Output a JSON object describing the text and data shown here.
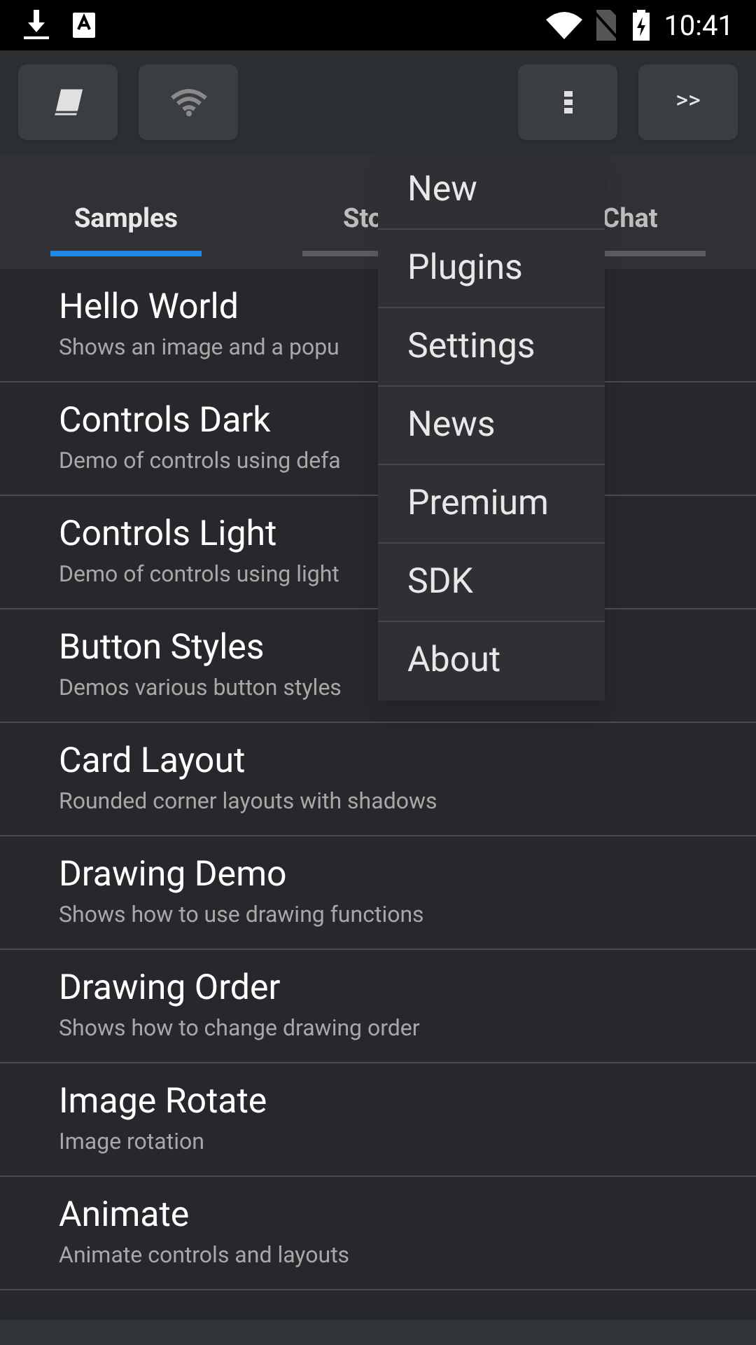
{
  "status_bar": {
    "time": "10:41"
  },
  "toolbar": {
    "forward_button": {
      "label": ">>"
    }
  },
  "tabs": [
    {
      "label": "Samples",
      "selected": true
    },
    {
      "label": "Sto",
      "selected": false
    },
    {
      "label": "Chat",
      "selected": false
    }
  ],
  "list": [
    {
      "title": "Hello World",
      "subtitle": "Shows an image and a popu"
    },
    {
      "title": "Controls Dark",
      "subtitle": "Demo of controls using defa"
    },
    {
      "title": "Controls Light",
      "subtitle": "Demo of controls using light"
    },
    {
      "title": "Button Styles",
      "subtitle": "Demos various button styles"
    },
    {
      "title": "Card Layout",
      "subtitle": "Rounded corner layouts with shadows"
    },
    {
      "title": "Drawing Demo",
      "subtitle": "Shows how to use drawing functions"
    },
    {
      "title": "Drawing Order",
      "subtitle": "Shows how to change drawing order"
    },
    {
      "title": "Image Rotate",
      "subtitle": "Image rotation"
    },
    {
      "title": "Animate",
      "subtitle": "Animate controls and layouts"
    }
  ],
  "menu": [
    "New",
    "Plugins",
    "Settings",
    "News",
    "Premium",
    "SDK",
    "About"
  ]
}
